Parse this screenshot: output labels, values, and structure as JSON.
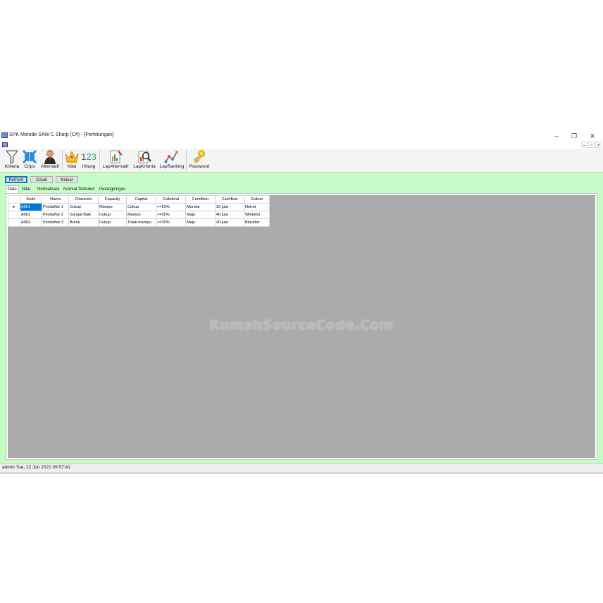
{
  "window": {
    "title": "SPK Metode SAW C Sharp (C#) - [Perhitungan]",
    "controls": {
      "minimize": "–",
      "restore": "❐",
      "close": "✕"
    },
    "mdi_controls": {
      "minimize": "–",
      "restore": "▫",
      "close": "×"
    }
  },
  "toolbar": {
    "items": [
      {
        "label": "Kriteria",
        "icon": "funnel-icon"
      },
      {
        "label": "Crips",
        "icon": "arrows-icon"
      },
      {
        "label": "Alternatif",
        "icon": "person-icon"
      },
      {
        "label": "Nilai",
        "icon": "crown-icon"
      },
      {
        "label": "Hitung",
        "icon": "numbers-icon",
        "glyph": "123"
      },
      {
        "label": "LapAlternatif",
        "icon": "report-icon"
      },
      {
        "label": "LapKriteria",
        "icon": "magnifier-report-icon"
      },
      {
        "label": "LapRanking",
        "icon": "chart-icon"
      },
      {
        "label": "Password",
        "icon": "keys-icon"
      }
    ]
  },
  "actions": {
    "refresh": "Refresh",
    "cetak": "Cetak",
    "keluar": "Keluar"
  },
  "tabs": [
    "Data",
    "Nilai",
    "Normalisasi",
    "Normal Terbobot",
    "Perangkingan"
  ],
  "active_tab": "Data",
  "grid": {
    "columns": [
      "Kode",
      "Nama",
      "Character",
      "Capacity",
      "Capital",
      "Collateral",
      "Condition",
      "Cashflow",
      "Culture"
    ],
    "rows": [
      [
        "A001",
        "Pendaftar 1",
        "Cukup",
        "Mampu",
        "Cukup",
        ">=20%",
        "Mundur",
        "20 juta",
        "Netral"
      ],
      [
        "A002",
        "Pendaftar 2",
        "Sangat Baik",
        "Cukup",
        "Mampu",
        ">=20%",
        "Maju",
        "40 juta",
        "Whitelist"
      ],
      [
        "A003",
        "Pendaftar 3",
        "Buruk",
        "Cukup",
        "Tidak mampu",
        ">=20%",
        "Maju",
        "40 juta",
        "Blacklist"
      ]
    ],
    "current_row_marker": "▸"
  },
  "watermark": "RumahSourceCode.Com",
  "status": {
    "text": "admin Tue, 22 Jun 2021 09:57:41"
  },
  "colors": {
    "background": "#c6fcc6",
    "grid_area": "#ababab",
    "selection": "#0078d7"
  }
}
